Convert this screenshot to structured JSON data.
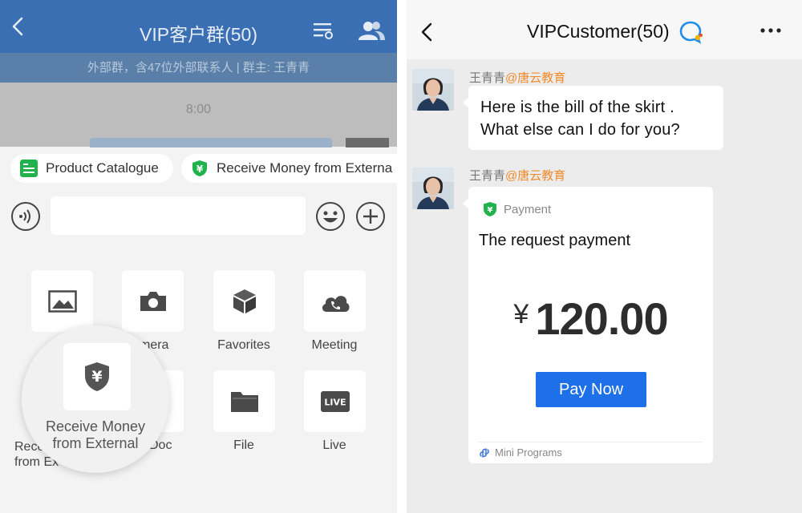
{
  "left_screen": {
    "header": {
      "title": "VIP客户群(50)"
    },
    "subheader": {
      "text": "外部群，含47位外部联系人 | 群主: 王青青"
    },
    "chat": {
      "time": "8:00"
    },
    "chips": [
      {
        "label": "Product Catalogue",
        "icon": "catalogue-icon"
      },
      {
        "label": "Receive Money from Externa",
        "icon": "yuan-shield-icon"
      }
    ],
    "input": {
      "value": "",
      "placeholder": ""
    },
    "tools": [
      {
        "label": "Album",
        "icon": "image-icon"
      },
      {
        "label": "Camera",
        "icon": "camera-icon"
      },
      {
        "label": "Favorites",
        "icon": "cube-icon"
      },
      {
        "label": "Meeting",
        "icon": "phone-cloud-icon"
      },
      {
        "label": "Receive Money from External",
        "icon": "yuan-shield-icon"
      },
      {
        "label": "Doc",
        "icon": "doc-icon"
      },
      {
        "label": "File",
        "icon": "folder-icon"
      },
      {
        "label": "Live",
        "icon": "live-icon"
      }
    ],
    "visible_labels": {
      "camera_partial": "mera",
      "doc_partial": "Doc",
      "rec_partial_line1": "Rece",
      "rec_partial_line2": "from Ex"
    },
    "magnifier": {
      "line1": "Receive Money",
      "line2": "from External"
    }
  },
  "right_screen": {
    "header": {
      "title": "VIPCustomer(50)"
    },
    "messages": [
      {
        "sender": "王青青",
        "org": "@唐云教育",
        "line1": "Here is the bill of the skirt .",
        "line2": "What else can I do for you?"
      },
      {
        "sender": "王青青",
        "org": "@唐云教育",
        "card": {
          "header": "Payment",
          "request": "The request payment",
          "currency": "¥",
          "amount": "120.00",
          "button": "Pay Now",
          "footer": "Mini Programs"
        }
      }
    ]
  },
  "colors": {
    "header_blue": "#3b6fb3",
    "pay_button": "#1e70e8",
    "wallet_green": "#21b24b",
    "org_orange": "#f08a2a"
  }
}
